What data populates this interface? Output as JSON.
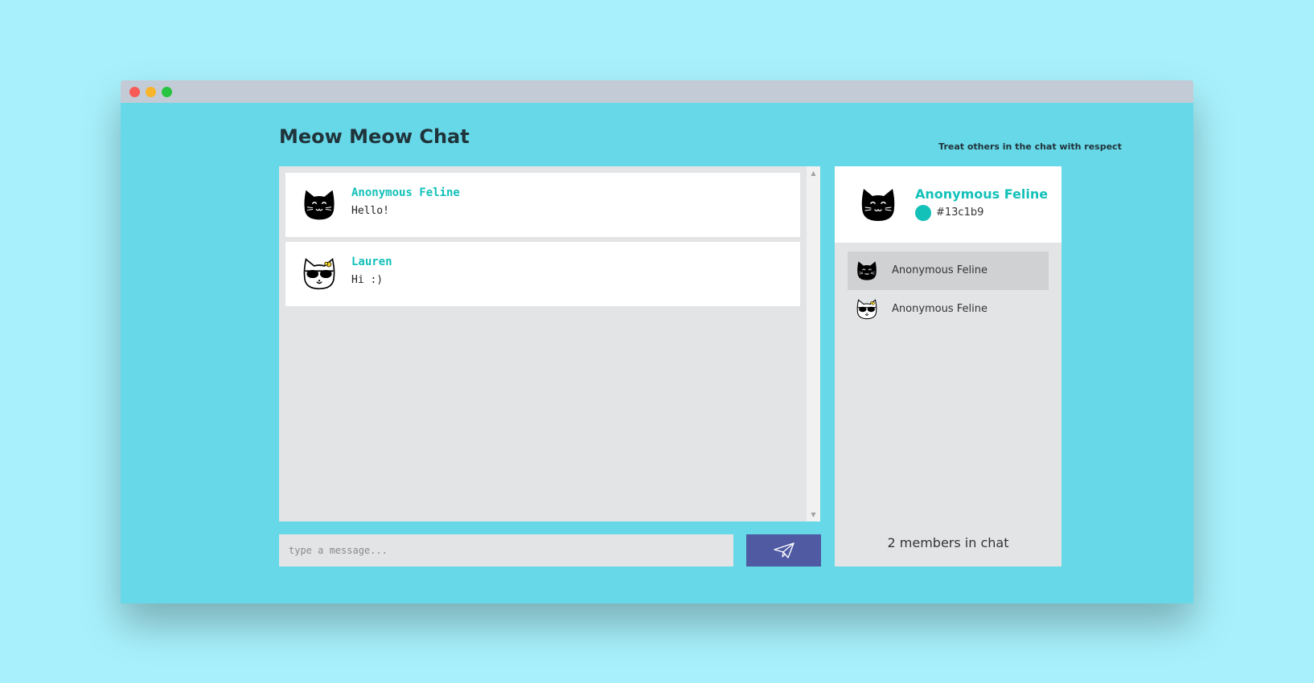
{
  "app": {
    "title": "Meow Meow Chat",
    "rules_note": "Treat others in the chat with respect"
  },
  "messages": [
    {
      "author": "Anonymous Feline",
      "text": "Hello!",
      "avatar_icon": "black-cat-icon"
    },
    {
      "author": "Lauren",
      "text": "Hi :)",
      "avatar_icon": "sunglasses-cat-icon"
    }
  ],
  "composer": {
    "placeholder": "type a message...",
    "value": "",
    "send_icon": "paper-plane-icon"
  },
  "profile": {
    "name": "Anonymous Feline",
    "color_code": "#13c1b9",
    "avatar_icon": "black-cat-icon"
  },
  "members": [
    {
      "name": "Anonymous Feline",
      "avatar_icon": "black-cat-icon",
      "active": true
    },
    {
      "name": "Anonymous Feline",
      "avatar_icon": "sunglasses-cat-icon",
      "active": false
    }
  ],
  "member_count_text": "2 members in chat",
  "colors": {
    "accent": "#13c1b9",
    "send_button": "#4f5aa3",
    "window_bg": "#67d8e8",
    "page_bg": "#a8f1fc"
  }
}
